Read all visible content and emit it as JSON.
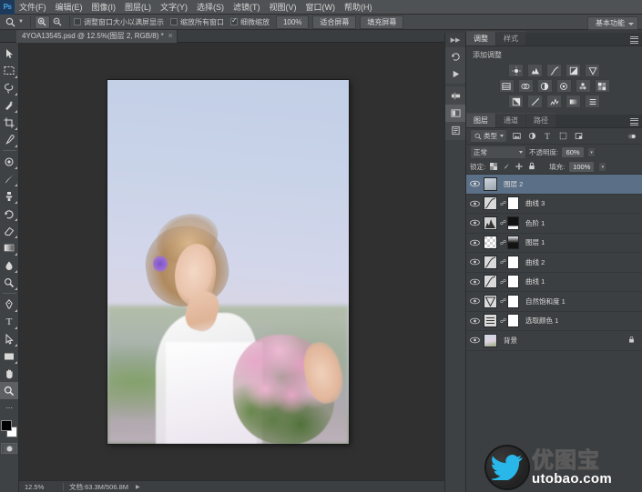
{
  "app": {
    "name": "Photoshop",
    "logo_text": "Ps"
  },
  "menubar": {
    "items": [
      {
        "label": "文件(F)"
      },
      {
        "label": "编辑(E)"
      },
      {
        "label": "图像(I)"
      },
      {
        "label": "图层(L)"
      },
      {
        "label": "文字(Y)"
      },
      {
        "label": "选择(S)"
      },
      {
        "label": "滤镜(T)"
      },
      {
        "label": "视图(V)"
      },
      {
        "label": "窗口(W)"
      },
      {
        "label": "帮助(H)"
      }
    ]
  },
  "optionsbar": {
    "tool_icon": "zoom-tool-icon",
    "zoom_in_icon": "zoom-in-icon",
    "zoom_out_icon": "zoom-out-icon",
    "resize_windows_label": "调整窗口大小以满屏显示",
    "zoom_all_windows_label": "缩放所有窗口",
    "scrubby_zoom_label": "细微缩放",
    "btn_100": "100%",
    "btn_fit_screen": "适合屏幕",
    "btn_fill_screen": "填充屏幕",
    "workspace": "基本功能"
  },
  "doctab": {
    "title": "4YOA13545.psd @ 12.5%(图层 2, RGB/8) *"
  },
  "toolbar": {
    "tools": [
      {
        "name": "move-tool",
        "glyph": "↖"
      },
      {
        "name": "marquee-tool",
        "glyph": "▭"
      },
      {
        "name": "lasso-tool",
        "glyph": "❂"
      },
      {
        "name": "quick-selection-tool",
        "glyph": "✐"
      },
      {
        "name": "crop-tool",
        "glyph": "⌗"
      },
      {
        "name": "eyedropper-tool",
        "glyph": "✑"
      },
      {
        "name": "spot-healing-brush-tool",
        "glyph": "◉"
      },
      {
        "name": "brush-tool",
        "glyph": "✒"
      },
      {
        "name": "clone-stamp-tool",
        "glyph": "⚓"
      },
      {
        "name": "history-brush-tool",
        "glyph": "⤵"
      },
      {
        "name": "eraser-tool",
        "glyph": "◢"
      },
      {
        "name": "gradient-tool",
        "glyph": "▤"
      },
      {
        "name": "blur-tool",
        "glyph": "●"
      },
      {
        "name": "dodge-tool",
        "glyph": "⚲"
      },
      {
        "name": "pen-tool",
        "glyph": "✒"
      },
      {
        "name": "type-tool",
        "glyph": "T"
      },
      {
        "name": "path-selection-tool",
        "glyph": "➤"
      },
      {
        "name": "rectangle-tool",
        "glyph": "▬"
      },
      {
        "name": "hand-tool",
        "glyph": "✋"
      },
      {
        "name": "zoom-tool",
        "glyph": "⚲"
      }
    ],
    "foreground_color": "#000000",
    "background_color": "#ffffff",
    "quickmask_icon": "quick-mask-icon"
  },
  "panel_rail": {
    "icons": [
      {
        "name": "history-icon",
        "glyph": "↺"
      },
      {
        "name": "actions-icon",
        "glyph": "▶"
      },
      {
        "name": "adjustments-rail-icon",
        "glyph": "◐"
      },
      {
        "name": "color-icon",
        "glyph": "▨"
      },
      {
        "name": "character-icon",
        "glyph": "≡"
      }
    ]
  },
  "adjustments_panel": {
    "tabs": [
      {
        "label": "调整",
        "active": true
      },
      {
        "label": "样式",
        "active": false
      }
    ],
    "title": "添加调整",
    "rows": [
      [
        {
          "name": "brightness-contrast-icon",
          "glyph": "☼"
        },
        {
          "name": "levels-icon",
          "glyph": "▆"
        },
        {
          "name": "curves-icon",
          "glyph": "↗"
        },
        {
          "name": "exposure-icon",
          "glyph": "◧"
        },
        {
          "name": "vibrance-icon",
          "glyph": "▽"
        }
      ],
      [
        {
          "name": "hue-saturation-icon",
          "glyph": "▥"
        },
        {
          "name": "color-balance-icon",
          "glyph": "⚖"
        },
        {
          "name": "black-white-icon",
          "glyph": "◑"
        },
        {
          "name": "photo-filter-icon",
          "glyph": "◍"
        },
        {
          "name": "channel-mixer-icon",
          "glyph": "∴"
        },
        {
          "name": "color-lookup-icon",
          "glyph": "▦"
        }
      ],
      [
        {
          "name": "invert-icon",
          "glyph": "◨"
        },
        {
          "name": "posterize-icon",
          "glyph": "╱"
        },
        {
          "name": "threshold-icon",
          "glyph": "◥"
        },
        {
          "name": "gradient-map-icon",
          "glyph": "▤"
        },
        {
          "name": "selective-color-icon",
          "glyph": "≡"
        }
      ]
    ]
  },
  "layers_panel": {
    "tabs": [
      {
        "label": "图层",
        "active": true
      },
      {
        "label": "通道",
        "active": false
      },
      {
        "label": "路径",
        "active": false
      }
    ],
    "filter": {
      "kind_label": "类型",
      "search_icon": "search-icon",
      "icons": [
        {
          "name": "filter-pixel-icon",
          "glyph": "▣"
        },
        {
          "name": "filter-adjustment-icon",
          "glyph": "◑"
        },
        {
          "name": "filter-type-icon",
          "glyph": "T"
        },
        {
          "name": "filter-shape-icon",
          "glyph": "◰"
        },
        {
          "name": "filter-smart-icon",
          "glyph": "◈"
        }
      ],
      "toggle_icon": "filter-toggle-icon"
    },
    "blend_mode": "正常",
    "opacity_label": "不透明度:",
    "opacity_value": "60%",
    "lock_label": "锁定:",
    "lock_icons": [
      {
        "name": "lock-transparent-icon",
        "glyph": "▦"
      },
      {
        "name": "lock-image-icon",
        "glyph": "✒"
      },
      {
        "name": "lock-position-icon",
        "glyph": "✛"
      },
      {
        "name": "lock-all-icon",
        "glyph": "⚿"
      }
    ],
    "fill_label": "填充:",
    "fill_value": "100%",
    "eye_icon": "eye-icon",
    "link_icon": "link-icon",
    "lock_badge_icon": "lock-icon",
    "layers": [
      {
        "name": "图层 2",
        "selected": true,
        "visible": true,
        "type": "pixel",
        "thumb": "#a9b0b8",
        "mask": null,
        "linked": false
      },
      {
        "name": "曲线 3",
        "selected": false,
        "visible": true,
        "type": "adjustment",
        "thumb": "#d9d9d9",
        "mask": "#ffffff",
        "linked": true
      },
      {
        "name": "色阶 1",
        "selected": false,
        "visible": true,
        "type": "adjustment",
        "thumb": "#cccccc",
        "mask": "#111111",
        "linked": true
      },
      {
        "name": "图层 1",
        "selected": false,
        "visible": true,
        "type": "pixel",
        "thumb": "#e8e8e8",
        "mask": "#1a1a1a",
        "linked": true
      },
      {
        "name": "曲线 2",
        "selected": false,
        "visible": true,
        "type": "adjustment",
        "thumb": "#d9d9d9",
        "mask": "#ffffff",
        "linked": true
      },
      {
        "name": "曲线 1",
        "selected": false,
        "visible": true,
        "type": "adjustment",
        "thumb": "#d9d9d9",
        "mask": "#ffffff",
        "linked": true
      },
      {
        "name": "自然饱和度 1",
        "selected": false,
        "visible": true,
        "type": "adjustment",
        "thumb": "#d9d9d9",
        "mask": "#ffffff",
        "linked": true
      },
      {
        "name": "选取颜色 1",
        "selected": false,
        "visible": true,
        "type": "adjustment",
        "thumb": "#d9d9d9",
        "mask": "#ffffff",
        "linked": true
      },
      {
        "name": "背景",
        "selected": false,
        "visible": true,
        "type": "background",
        "thumb": "#c8c2cf",
        "mask": null,
        "linked": false,
        "locked": true
      }
    ]
  },
  "statusbar": {
    "zoom": "12.5%",
    "doc_size_label": "文档:63.3M/506.8M",
    "arrow_icon": "status-arrow-icon"
  },
  "canvas": {
    "document_name": "4YOA13545.psd",
    "image_alt": "bride-with-bouquet-photo"
  },
  "watermark": {
    "cn": "优图宝",
    "en": "utobao.com",
    "bird_icon": "twitter-bird-icon",
    "accent_color": "#29b6e8"
  },
  "colors": {
    "panel_bg": "#3c3f41",
    "menu_bg": "#4f5254",
    "canvas_bg": "#303030",
    "selection_blue": "#5b6f86"
  }
}
